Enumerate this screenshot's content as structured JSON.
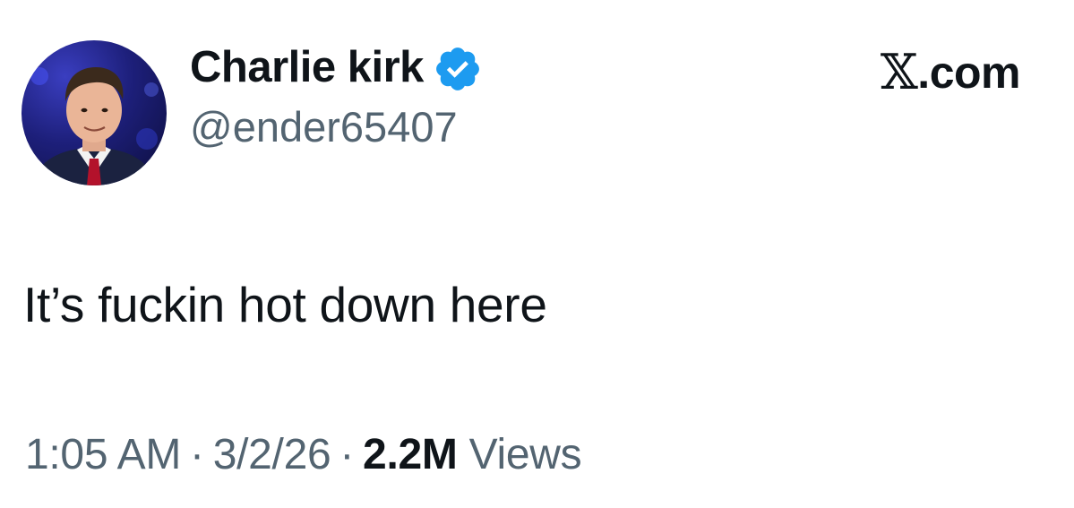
{
  "tweet": {
    "author": {
      "display_name": "Charlie kirk",
      "handle": "@ender65407",
      "verified": true,
      "avatar_icon": "profile-photo"
    },
    "brand": {
      "glyph": "𝕏",
      "suffix": ".com"
    },
    "text": "It’s fuckin hot down here",
    "meta": {
      "time": "1:05 AM",
      "separator": "·",
      "date": "3/2/26",
      "views_count": "2.2M",
      "views_label": "Views"
    }
  },
  "colors": {
    "text_primary": "#0f1419",
    "text_secondary": "#536471",
    "verified_blue": "#1d9bf0",
    "background": "#ffffff"
  }
}
